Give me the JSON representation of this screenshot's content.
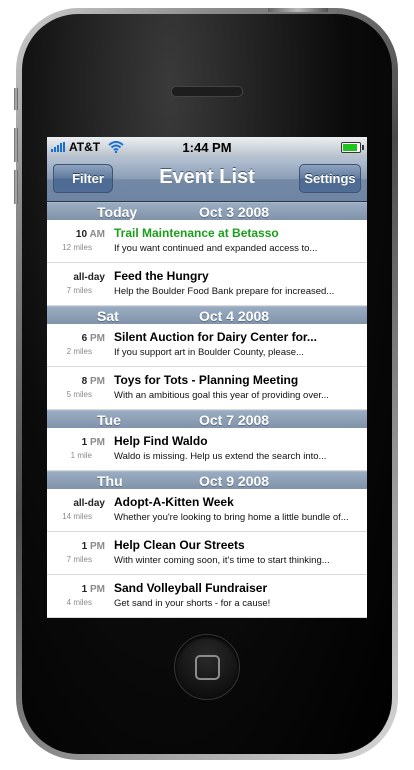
{
  "status": {
    "carrier": "AT&T",
    "time": "1:44 PM",
    "battery_level": 0.9,
    "signal_bars": 5
  },
  "navbar": {
    "title": "Event List",
    "left_button": "Filter",
    "right_button": "Settings"
  },
  "colors": {
    "highlight_title": "#1a9f1a",
    "navbar": "#7389a6",
    "section_header": "#8a9bb1"
  },
  "sections": [
    {
      "day": "Today",
      "date": "Oct 3 2008",
      "events": [
        {
          "time": "10",
          "ampm": "AM",
          "miles": "12 miles",
          "title": "Trail Maintenance at Betasso",
          "desc": "If you want continued and expanded access to...",
          "highlight": true
        },
        {
          "time": "all-day",
          "ampm": "",
          "miles": "7 miles",
          "title": "Feed the Hungry",
          "desc": "Help the Boulder Food Bank prepare for increased..."
        }
      ]
    },
    {
      "day": "Sat",
      "date": "Oct 4 2008",
      "events": [
        {
          "time": "6",
          "ampm": "PM",
          "miles": "2 miles",
          "title": "Silent Auction for Dairy Center for...",
          "desc": "If you support art in Boulder County, please..."
        },
        {
          "time": "8",
          "ampm": "PM",
          "miles": "5 miles",
          "title": "Toys for Tots - Planning Meeting",
          "desc": "With an ambitious goal this year of providing over..."
        }
      ]
    },
    {
      "day": "Tue",
      "date": "Oct 7 2008",
      "events": [
        {
          "time": "1",
          "ampm": "PM",
          "miles": "1 mile",
          "title": "Help Find Waldo",
          "desc": "Waldo is missing. Help us extend the search into..."
        }
      ]
    },
    {
      "day": "Thu",
      "date": "Oct 9 2008",
      "events": [
        {
          "time": "all-day",
          "ampm": "",
          "miles": "14 miles",
          "title": "Adopt-A-Kitten Week",
          "desc": "Whether you're looking to bring home a little bundle of..."
        },
        {
          "time": "1",
          "ampm": "PM",
          "miles": "7 miles",
          "title": "Help Clean Our Streets",
          "desc": "With winter coming soon, it's time to start thinking..."
        },
        {
          "time": "1",
          "ampm": "PM",
          "miles": "4 miles",
          "title": "Sand Volleyball Fundraiser",
          "desc": "Get sand in your shorts - for a cause!"
        }
      ]
    }
  ]
}
